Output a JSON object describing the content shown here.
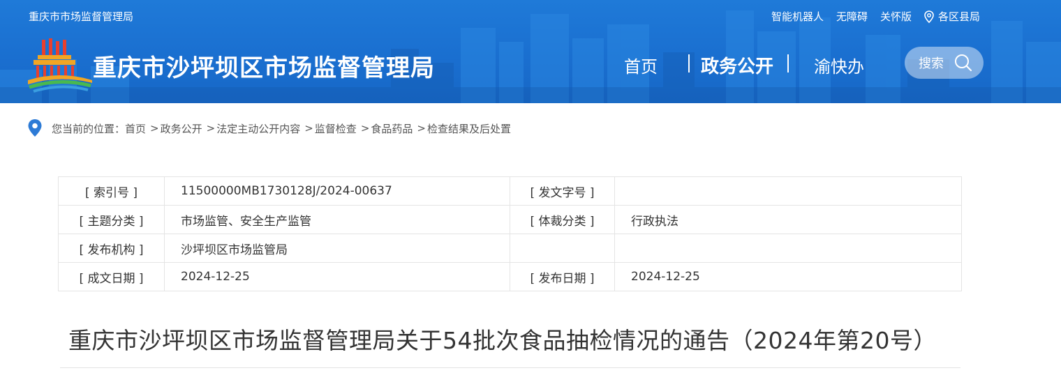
{
  "header": {
    "top_site_name": "重庆市市场监督管理局",
    "top_links": {
      "robot": "智能机器人",
      "accessibility": "无障碍",
      "care_mode": "关怀版",
      "districts": "各区县局"
    },
    "site_title": "重庆市沙坪坝区市场监督管理局",
    "nav": {
      "home": "首页",
      "gov_affairs": "政务公开",
      "yukuaiban": "渝快办"
    },
    "search_label": "搜索",
    "colors": {
      "bar": "#1a6fd0",
      "search_bg": "rgba(255,255,255,0.45)"
    }
  },
  "breadcrumb": {
    "prefix": "您当前的位置：",
    "items": [
      "首页",
      "政务公开",
      "法定主动公开内容",
      "监督检查",
      "食品药品",
      "检查结果及后处置"
    ],
    "separator": ">"
  },
  "meta": {
    "rows": [
      {
        "label1": "[ 索引号 ]",
        "value1": "11500000MB1730128J/2024-00637",
        "label2": "[ 发文字号 ]",
        "value2": ""
      },
      {
        "label1": "[ 主题分类 ]",
        "value1": "市场监管、安全生产监管",
        "label2": "[ 体裁分类 ]",
        "value2": "行政执法"
      },
      {
        "label1": "[ 发布机构 ]",
        "value1": "沙坪坝区市场监管局",
        "label2": "",
        "value2": ""
      },
      {
        "label1": "[ 成文日期 ]",
        "value1": "2024-12-25",
        "label2": "[ 发布日期 ]",
        "value2": "2024-12-25"
      }
    ]
  },
  "article": {
    "title": "重庆市沙坪坝区市场监督管理局关于54批次食品抽检情况的通告（2024年第20号）"
  },
  "icons": {
    "location": "location-pin-icon",
    "search": "search-icon",
    "logo": "site-logo-emblem",
    "breadcrumb_pin": "map-pin-icon"
  }
}
